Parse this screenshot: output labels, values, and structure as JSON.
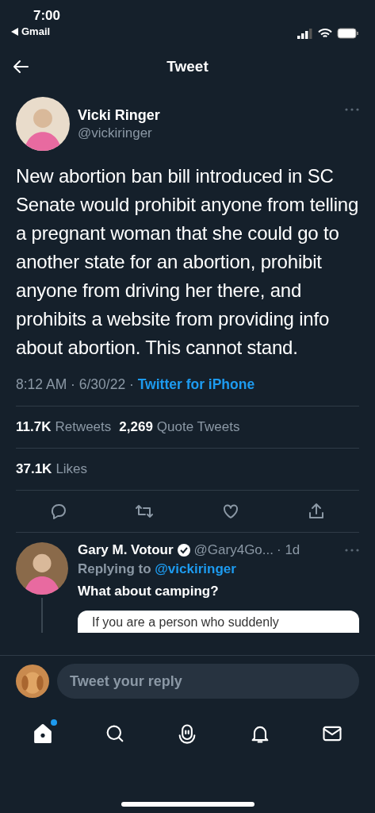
{
  "status_bar": {
    "time": "7:00",
    "back_app": "Gmail"
  },
  "header": {
    "title": "Tweet"
  },
  "tweet": {
    "author": {
      "name": "Vicki Ringer",
      "handle": "@vickiringer"
    },
    "text": "New abortion ban bill introduced in SC Senate would prohibit anyone from telling a pregnant woman that she could go to another state for an abortion, prohibit anyone from driving her there, and prohibits a website from providing info about abortion. This cannot stand.",
    "timestamp": "8:12 AM · 6/30/22 · ",
    "source": "Twitter for iPhone",
    "stats": [
      {
        "count": "11.7K",
        "label": "Retweets"
      },
      {
        "count": "2,269",
        "label": "Quote Tweets"
      }
    ],
    "likes": {
      "count": "37.1K",
      "label": "Likes"
    },
    "actions": [
      {
        "kind": "reply"
      },
      {
        "kind": "retweet"
      },
      {
        "kind": "like"
      },
      {
        "kind": "share"
      }
    ]
  },
  "reply": {
    "author": {
      "name": "Gary M. Votour",
      "verified": true,
      "handle": "@Gary4Go...",
      "time": "· 1d"
    },
    "replying_to": "Replying to",
    "replying_handle": "@vickiringer",
    "text": "What about camping?",
    "card_text": "If you are a person who suddenly"
  },
  "composer": {
    "placeholder": "Tweet your reply"
  },
  "tab_bar": [
    {
      "kind": "home",
      "selected": true,
      "dot": true
    },
    {
      "kind": "search",
      "selected": false,
      "dot": false
    },
    {
      "kind": "spaces",
      "selected": false,
      "dot": false
    },
    {
      "kind": "notifications",
      "selected": false,
      "dot": false
    },
    {
      "kind": "messages",
      "selected": false,
      "dot": false
    }
  ]
}
